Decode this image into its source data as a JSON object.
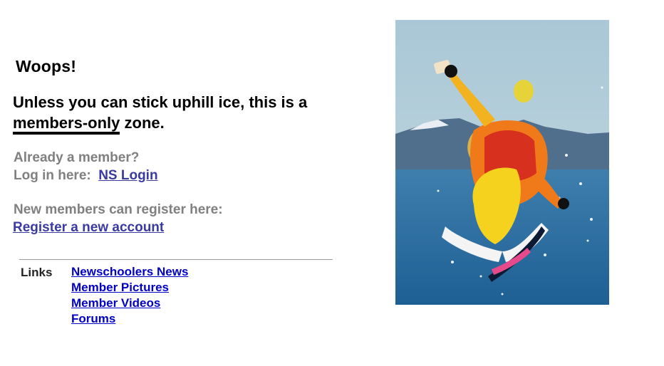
{
  "error": {
    "title": "Woops!",
    "headline_pre": "Unless you can stick uphill ice, this is a",
    "headline_emph": "members-only",
    "headline_post": "zone."
  },
  "login": {
    "already_text": "Already a member?",
    "login_here_text": "Log in here:",
    "login_link": "NS Login"
  },
  "register": {
    "prompt_text": "New members can register here:",
    "register_link": "Register a new account"
  },
  "links": {
    "label": "Links",
    "items": [
      "Newschoolers News",
      "Member Pictures",
      "Member Videos",
      "Forums"
    ]
  },
  "photo": {
    "icon": "skier-photo"
  },
  "colors": {
    "link_blue": "#0000c8",
    "link_muted": "#3a3aa0",
    "gray_text": "#808080"
  }
}
